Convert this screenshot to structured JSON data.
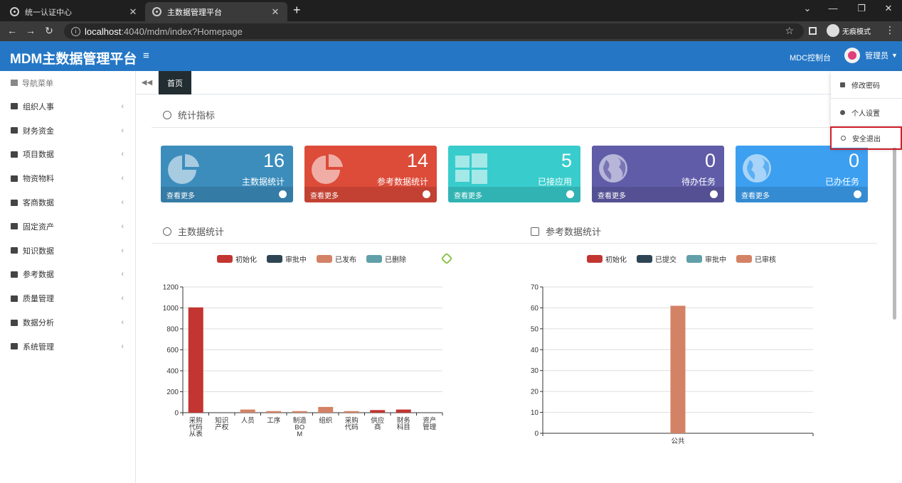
{
  "browser": {
    "tabs": [
      {
        "title": "统一认证中心",
        "active": false
      },
      {
        "title": "主数据管理平台",
        "active": true
      }
    ],
    "url_host": "localhost",
    "url_rest": ":4040/mdm/index?Homepage",
    "incognito_label": "无痕模式"
  },
  "header": {
    "brand": "MDM主数据管理平台",
    "console_link": "MDC控制台",
    "user_name": "管理员"
  },
  "user_menu": {
    "items": [
      {
        "label": "修改密码",
        "icon": "user-icon"
      },
      {
        "label": "个人设置",
        "icon": "gear-icon"
      },
      {
        "label": "安全退出",
        "icon": "power-icon",
        "highlighted": true
      }
    ]
  },
  "sidebar": {
    "heading": "导航菜单",
    "items": [
      {
        "label": "组织人事",
        "icon": "users-icon"
      },
      {
        "label": "财务资金",
        "icon": "card-icon"
      },
      {
        "label": "项目数据",
        "icon": "sitemap-icon"
      },
      {
        "label": "物资物料",
        "icon": "cubes-icon"
      },
      {
        "label": "客商数据",
        "icon": "briefcase-icon"
      },
      {
        "label": "固定资产",
        "icon": "archive-icon"
      },
      {
        "label": "知识数据",
        "icon": "file-icon"
      },
      {
        "label": "参考数据",
        "icon": "list-icon"
      },
      {
        "label": "质量管理",
        "icon": "table-icon"
      },
      {
        "label": "数据分析",
        "icon": "line-chart-icon"
      },
      {
        "label": "系统管理",
        "icon": "wrench-icon"
      }
    ]
  },
  "tabbar": {
    "home_tab": "首页"
  },
  "stats_section": {
    "title": "统计指标"
  },
  "stat_boxes": [
    {
      "value": "16",
      "label": "主数据统计",
      "more": "查看更多",
      "color": "#3c8dbc",
      "icon": "pie-chart-icon"
    },
    {
      "value": "14",
      "label": "参考数据统计",
      "more": "查看更多",
      "color": "#dd4b39",
      "icon": "pie-chart-icon"
    },
    {
      "value": "5",
      "label": "已接应用",
      "more": "查看更多",
      "color": "#39cccc",
      "icon": "windows-icon"
    },
    {
      "value": "0",
      "label": "待办任务",
      "more": "查看更多",
      "color": "#605ca8",
      "icon": "globe-icon"
    },
    {
      "value": "0",
      "label": "已办任务",
      "more": "查看更多",
      "color": "#3c9ff0",
      "icon": "globe-icon"
    }
  ],
  "charts_titles": {
    "left": "主数据统计",
    "right": "参考数据统计"
  },
  "chart_data": [
    {
      "type": "bar",
      "title": "主数据统计",
      "legend": [
        "初始化",
        "审批中",
        "已发布",
        "已删除"
      ],
      "legend_colors": [
        "#c23531",
        "#2f4554",
        "#d48265",
        "#61a0a8"
      ],
      "categories": [
        "采购代码从表",
        "知识产权",
        "人员",
        "工序",
        "制造BOM",
        "组织",
        "采购代码",
        "供应商",
        "财务科目",
        "资产管理"
      ],
      "category_lines": [
        [
          "采购",
          "代码",
          "从表"
        ],
        [
          "知识",
          "产权"
        ],
        [
          "人员"
        ],
        [
          "工序"
        ],
        [
          "制造",
          "BO",
          "M"
        ],
        [
          "组织"
        ],
        [
          "采购",
          "代码"
        ],
        [
          "供应",
          "商"
        ],
        [
          "财务",
          "科目"
        ],
        [
          "资产",
          "管理"
        ]
      ],
      "series": [
        {
          "name": "初始化",
          "color": "#c23531",
          "values": [
            1005,
            0,
            0,
            0,
            0,
            0,
            0,
            25,
            30,
            0
          ]
        },
        {
          "name": "审批中",
          "color": "#2f4554",
          "values": [
            0,
            0,
            0,
            0,
            0,
            0,
            0,
            0,
            0,
            0
          ]
        },
        {
          "name": "已发布",
          "color": "#d48265",
          "values": [
            0,
            0,
            30,
            15,
            15,
            55,
            15,
            0,
            0,
            0
          ]
        },
        {
          "name": "已删除",
          "color": "#61a0a8",
          "values": [
            0,
            0,
            0,
            0,
            0,
            0,
            0,
            0,
            0,
            0
          ]
        }
      ],
      "yticks": [
        0,
        200,
        400,
        600,
        800,
        1000,
        1200
      ],
      "ylim": [
        0,
        1200
      ]
    },
    {
      "type": "bar",
      "title": "参考数据统计",
      "legend": [
        "初始化",
        "已提交",
        "审批中",
        "已审核"
      ],
      "legend_colors": [
        "#c23531",
        "#2f4554",
        "#61a0a8",
        "#d48265"
      ],
      "categories": [
        "公共"
      ],
      "category_lines": [
        [
          "公共"
        ]
      ],
      "series": [
        {
          "name": "已审核",
          "color": "#d48265",
          "values": [
            61
          ]
        }
      ],
      "yticks": [
        0,
        10,
        20,
        30,
        40,
        50,
        60,
        70
      ],
      "ylim": [
        0,
        70
      ]
    }
  ]
}
